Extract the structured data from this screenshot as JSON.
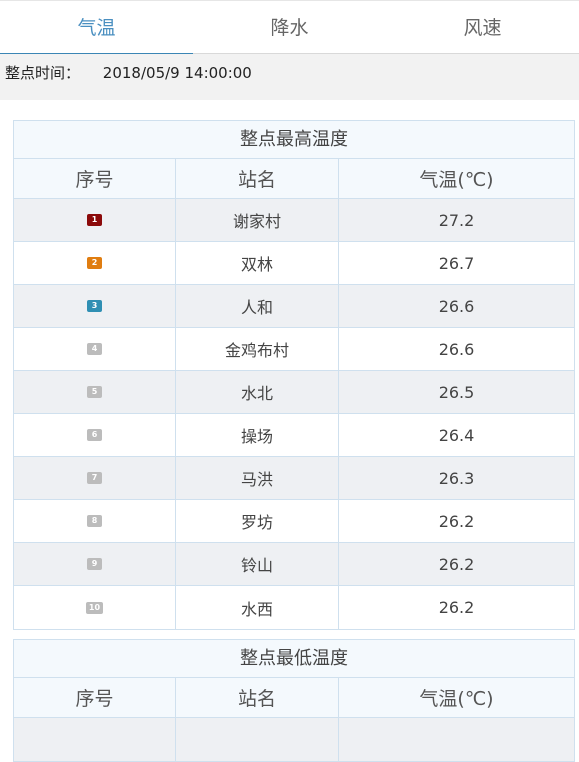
{
  "tabs": [
    {
      "label": "气温",
      "active": true
    },
    {
      "label": "降水",
      "active": false
    },
    {
      "label": "风速",
      "active": false
    }
  ],
  "time_bar": {
    "label": "整点时间：",
    "value": "2018/05/9 14:00:00"
  },
  "max_table": {
    "title": "整点最高温度",
    "headers": [
      "序号",
      "站名",
      "气温(℃)"
    ],
    "rows": [
      {
        "rank": "1",
        "station": "谢家村",
        "temp": "27.2"
      },
      {
        "rank": "2",
        "station": "双林",
        "temp": "26.7"
      },
      {
        "rank": "3",
        "station": "人和",
        "temp": "26.6"
      },
      {
        "rank": "4",
        "station": "金鸡布村",
        "temp": "26.6"
      },
      {
        "rank": "5",
        "station": "水北",
        "temp": "26.5"
      },
      {
        "rank": "6",
        "station": "操场",
        "temp": "26.4"
      },
      {
        "rank": "7",
        "station": "马洪",
        "temp": "26.3"
      },
      {
        "rank": "8",
        "station": "罗坊",
        "temp": "26.2"
      },
      {
        "rank": "9",
        "station": "铃山",
        "temp": "26.2"
      },
      {
        "rank": "10",
        "station": "水西",
        "temp": "26.2"
      }
    ]
  },
  "min_table": {
    "title": "整点最低温度",
    "headers": [
      "序号",
      "站名",
      "气温(℃)"
    ]
  },
  "colors": {
    "accent": "#3b86b5",
    "rank_1": "#8b0a0a",
    "rank_2": "#e07d10",
    "rank_3": "#2f8fb3",
    "rank_default": "#bcbcbc"
  }
}
